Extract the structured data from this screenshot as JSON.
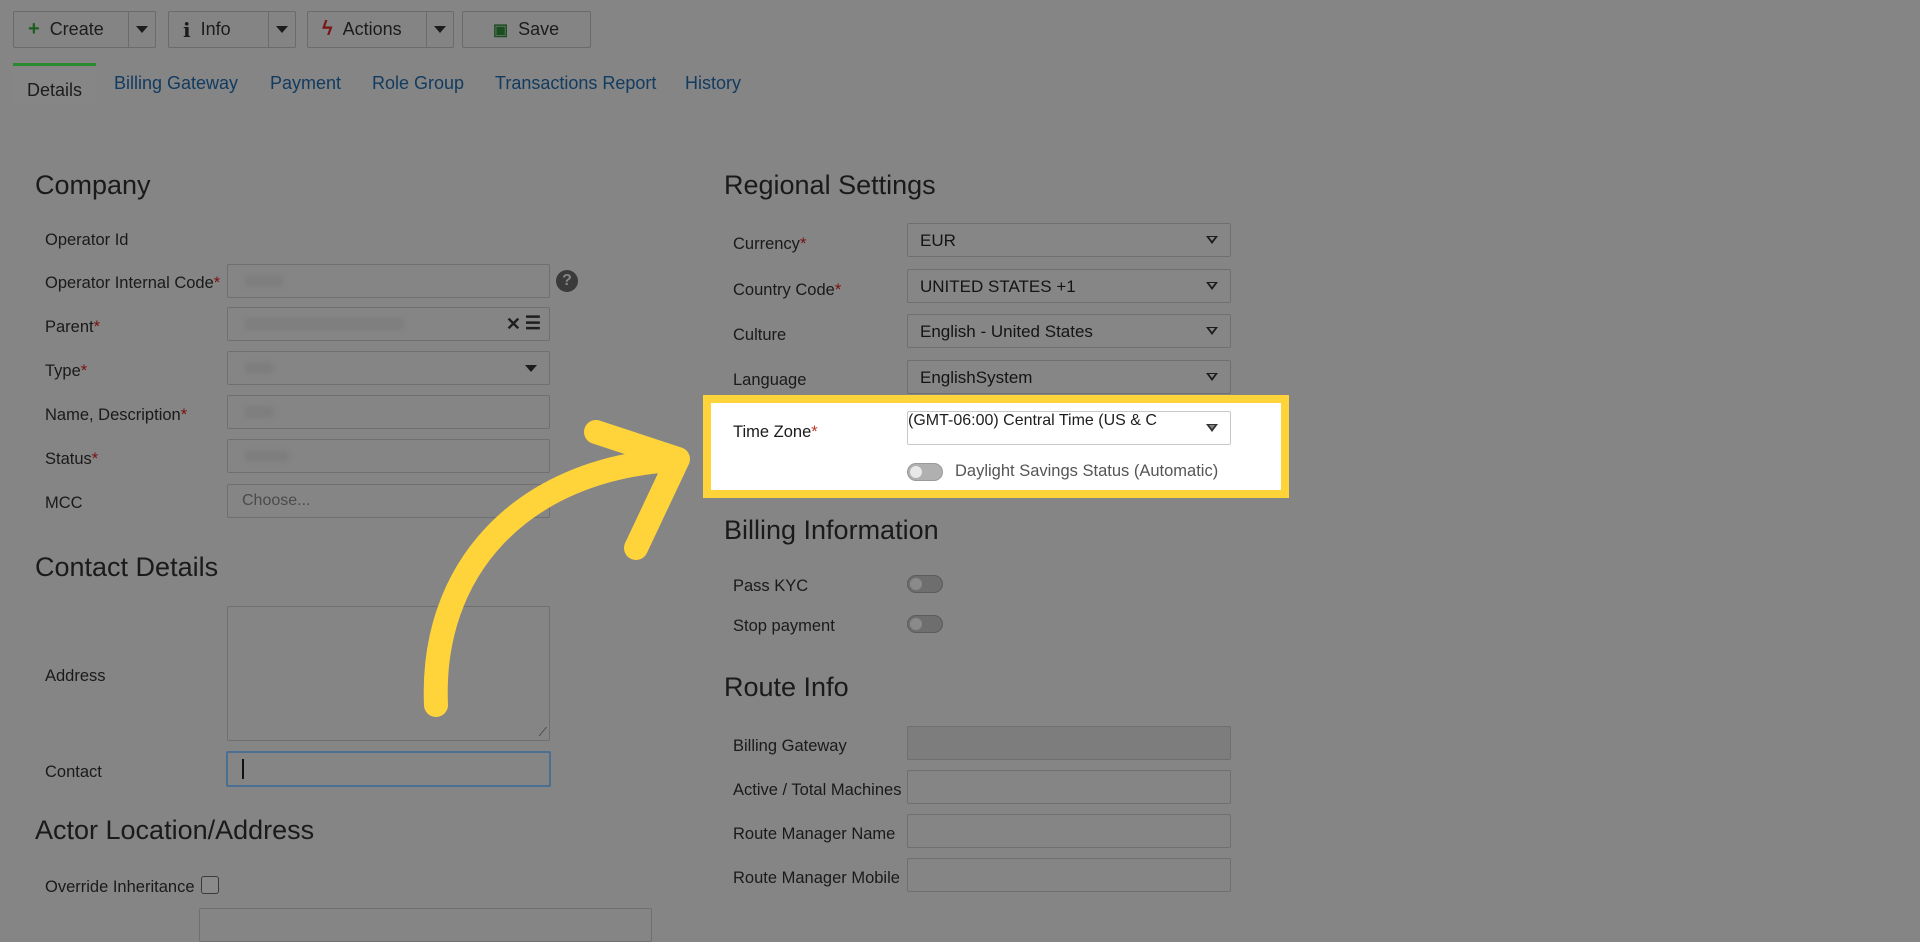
{
  "toolbar": {
    "create_label": "Create",
    "info_label": "Info",
    "actions_label": "Actions",
    "save_label": "Save"
  },
  "tabs": [
    {
      "label": "Details"
    },
    {
      "label": "Billing Gateway"
    },
    {
      "label": "Payment"
    },
    {
      "label": "Role Group"
    },
    {
      "label": "Transactions Report"
    },
    {
      "label": "History"
    }
  ],
  "company": {
    "title": "Company",
    "operator_id_label": "Operator Id",
    "internal_code_label": "Operator Internal Code",
    "parent_label": "Parent",
    "type_label": "Type",
    "name_label": "Name, Description",
    "status_label": "Status",
    "mcc_label": "MCC",
    "mcc_placeholder": "Choose..."
  },
  "contact": {
    "title": "Contact Details",
    "address_label": "Address",
    "contact_label": "Contact"
  },
  "actor": {
    "title": "Actor Location/Address",
    "override_label": "Override Inheritance"
  },
  "regional": {
    "title": "Regional Settings",
    "currency_label": "Currency",
    "currency_value": "EUR",
    "country_label": "Country Code",
    "country_value": "UNITED STATES +1",
    "culture_label": "Culture",
    "culture_value": "English - United States",
    "language_label": "Language",
    "language_value": "EnglishSystem",
    "timezone_label": "Time Zone",
    "timezone_value": "(GMT-06:00) Central Time (US & C",
    "dst_label": "Daylight Savings Status (Automatic)"
  },
  "billing": {
    "title": "Billing Information",
    "kyc_label": "Pass KYC",
    "stop_label": "Stop payment"
  },
  "route": {
    "title": "Route Info",
    "gateway_label": "Billing Gateway",
    "machines_label": "Active / Total Machines",
    "manager_label": "Route Manager Name",
    "mobile_label": "Route Manager Mobile"
  },
  "colors": {
    "highlight": "#ffd43b",
    "overlay": "#858585"
  }
}
